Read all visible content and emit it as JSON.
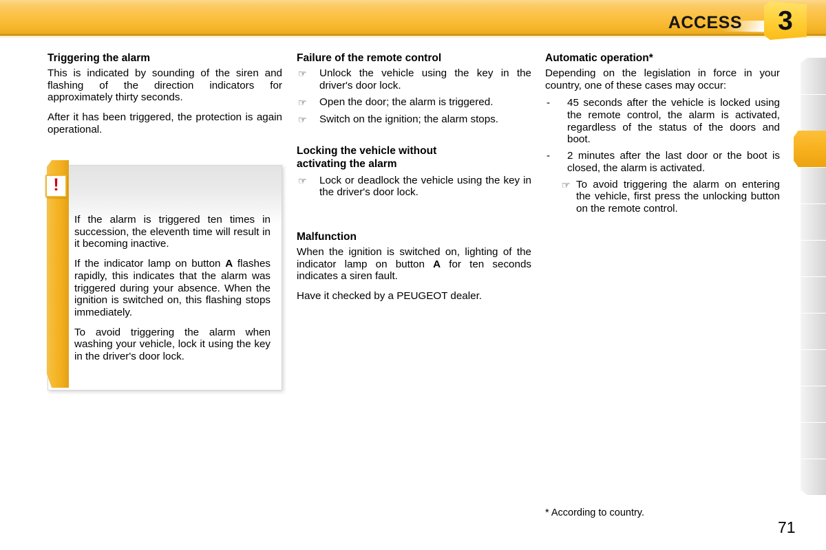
{
  "header": {
    "title": "ACCESS",
    "chapter_number": "3",
    "accent_color": "#f7b72c",
    "title_color": "#161616"
  },
  "tabstrip": {
    "total_tabs": 12,
    "active_index": 3,
    "active_color": "#f7b01c",
    "inactive_color": "#e4e4e4"
  },
  "columns": {
    "left": {
      "section_title": "Triggering the alarm",
      "paragraphs": [
        "This is indicated by sounding of the siren and flashing of the direction indicators for approximately thirty seconds.",
        "After it has been triggered, the protection is again operational."
      ]
    },
    "middle": {
      "section1_title": "Failure of the remote control",
      "section1_items": [
        "Unlock the vehicle using the key in the driver's door lock.",
        "Open the door; the alarm is triggered.",
        "Switch on the ignition; the alarm stops."
      ],
      "section2_title_line1": "Locking the vehicle without",
      "section2_title_line2": "activating the alarm",
      "section2_items": [
        "Lock or deadlock the vehicle using the key in the driver's door lock."
      ],
      "section3_title": "Malfunction",
      "section3_paragraphs": [
        "When the ignition is switched on, lighting of the indicator lamp on button A for ten seconds indicates a siren fault.",
        "Have it checked by a PEUGEOT dealer."
      ],
      "section3_para1_pre": "When the ignition is switched on, lighting of the indicator lamp on button ",
      "section3_para1_bold": "A",
      "section3_para1_post": " for ten seconds indicates a siren fault."
    },
    "right": {
      "section_title": "Automatic operation*",
      "intro": "Depending on the legislation in force in your country, one of these cases may occur:",
      "items": [
        "45 seconds after the vehicle is locked using the remote control, the alarm is activated, regardless of the status of the doors and boot.",
        "2 minutes after the last door or the boot is closed, the alarm is activated."
      ],
      "nested_note": "To avoid triggering the alarm on entering the vehicle, first press the unlocking button on the remote control.",
      "dash_marker": "-"
    }
  },
  "warning_box": {
    "icon_glyph": "!",
    "icon_color": "#cc0017",
    "bar_color": "#f6b92f",
    "paragraphs": [
      "If the alarm is triggered ten times in succession, the eleventh time will result in it becoming inactive.",
      "If the indicator lamp on button A flashes rapidly, this indicates that the alarm was triggered during your absence. When the ignition is switched on, this flashing stops immediately.",
      "To avoid triggering the alarm when washing your vehicle, lock it using the key in the driver's door lock."
    ],
    "para2_pre": "If the indicator lamp on button ",
    "para2_bold": "A",
    "para2_post": " flashes rapidly, this indicates that the alarm was triggered during your absence. When the ignition is switched on, this flashing stops immediately."
  },
  "footer": {
    "footnote": "* According to country.",
    "page_number": "71"
  },
  "icons": {
    "hand_pointer": "☞"
  }
}
